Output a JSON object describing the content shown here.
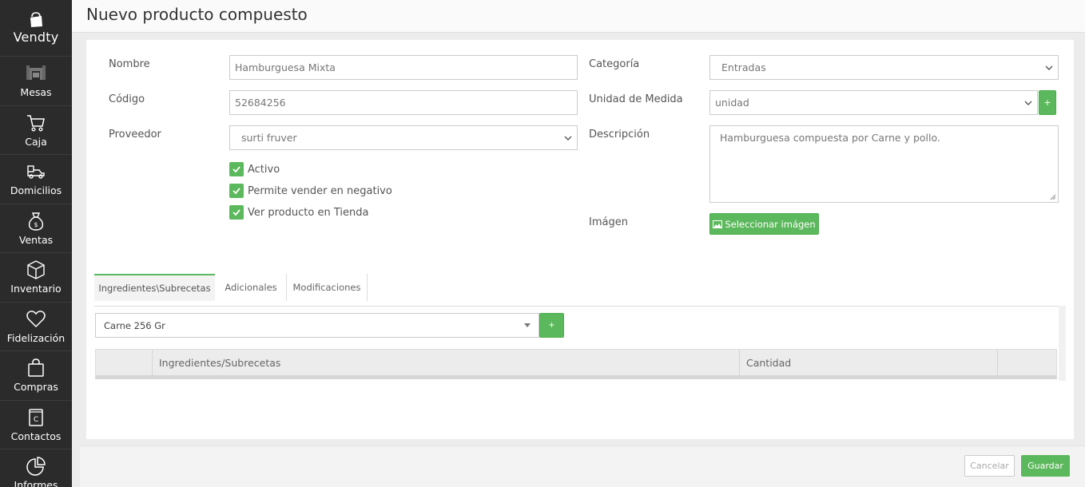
{
  "app": {
    "logo_text": "Vendty"
  },
  "sidebar": {
    "items": [
      {
        "label": "Mesas",
        "icon": "table-icon"
      },
      {
        "label": "Caja",
        "icon": "cart-icon"
      },
      {
        "label": "Domicilios",
        "icon": "delivery-icon"
      },
      {
        "label": "Ventas",
        "icon": "money-bag-icon"
      },
      {
        "label": "Inventario",
        "icon": "box-icon"
      },
      {
        "label": "Fidelización",
        "icon": "heart-icon"
      },
      {
        "label": "Compras",
        "icon": "shopping-bag-icon"
      },
      {
        "label": "Contactos",
        "icon": "contacts-book-icon"
      },
      {
        "label": "Informes",
        "icon": "pie-chart-icon"
      }
    ]
  },
  "header": {
    "title": "Nuevo producto compuesto"
  },
  "form": {
    "nombre": {
      "label": "Nombre",
      "value": "Hamburguesa Mixta"
    },
    "codigo": {
      "label": "Código",
      "value": "52684256"
    },
    "proveedor": {
      "label": "Proveedor",
      "value": "surti fruver"
    },
    "categoria": {
      "label": "Categoría",
      "value": "Entradas"
    },
    "unidad": {
      "label": "Unidad de Medida",
      "value": "unidad",
      "add_label": "+"
    },
    "descripcion": {
      "label": "Descripción",
      "value": "Hamburguesa compuesta por Carne y pollo."
    },
    "imagen": {
      "label": "Imágen",
      "button_label": "Seleccionar imágen"
    },
    "checks": [
      {
        "label": "Activo",
        "checked": true
      },
      {
        "label": "Permite vender en negativo",
        "checked": true
      },
      {
        "label": "Ver producto en Tienda",
        "checked": true
      }
    ]
  },
  "tabs": [
    {
      "label": "Ingredientes\\Subrecetas",
      "active": true
    },
    {
      "label": "Adicionales",
      "active": false
    },
    {
      "label": "Modificaciones",
      "active": false
    }
  ],
  "ingredients": {
    "selected": "Carne 256 Gr",
    "add_label": "+",
    "columns": [
      "",
      "Ingredientes/Subrecetas",
      "Cantidad",
      ""
    ]
  },
  "footer": {
    "cancel_label": "Cancelar",
    "save_label": "Guardar"
  },
  "colors": {
    "sidebar": "#2b2b2b",
    "accent": "#5cb85c"
  }
}
